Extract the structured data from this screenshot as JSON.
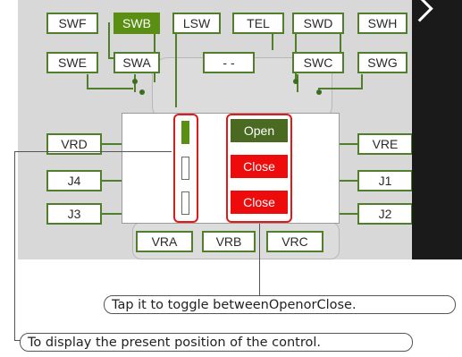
{
  "switches": {
    "swf": "SWF",
    "swb": "SWB",
    "lsw": "LSW",
    "tel": "TEL",
    "swd": "SWD",
    "swh": "SWH",
    "swe": "SWE",
    "swa": "SWA",
    "mid": "- -",
    "swc": "SWC",
    "swg": "SWG"
  },
  "controls": {
    "vrd": "VRD",
    "j4": "J4",
    "j3": "J3",
    "vre": "VRE",
    "j1": "J1",
    "j2": "J2",
    "vra": "VRA",
    "vrb": "VRB",
    "vrc": "VRC"
  },
  "toggles": [
    {
      "label": "Open",
      "state": "open"
    },
    {
      "label": "Close",
      "state": "close"
    },
    {
      "label": "Close",
      "state": "close"
    }
  ],
  "indicators": [
    true,
    false,
    false
  ],
  "callouts": {
    "toggle": {
      "prefix": "Tap it to toggle between ",
      "open": "Open",
      "or": " or ",
      "close": "Close",
      "suffix": "."
    },
    "position": "To display the present position of the control."
  },
  "colors": {
    "active": "#5a8f14",
    "open_button": "#4a6a22",
    "close_button": "#ee0b0b",
    "highlight": "#e11919"
  }
}
